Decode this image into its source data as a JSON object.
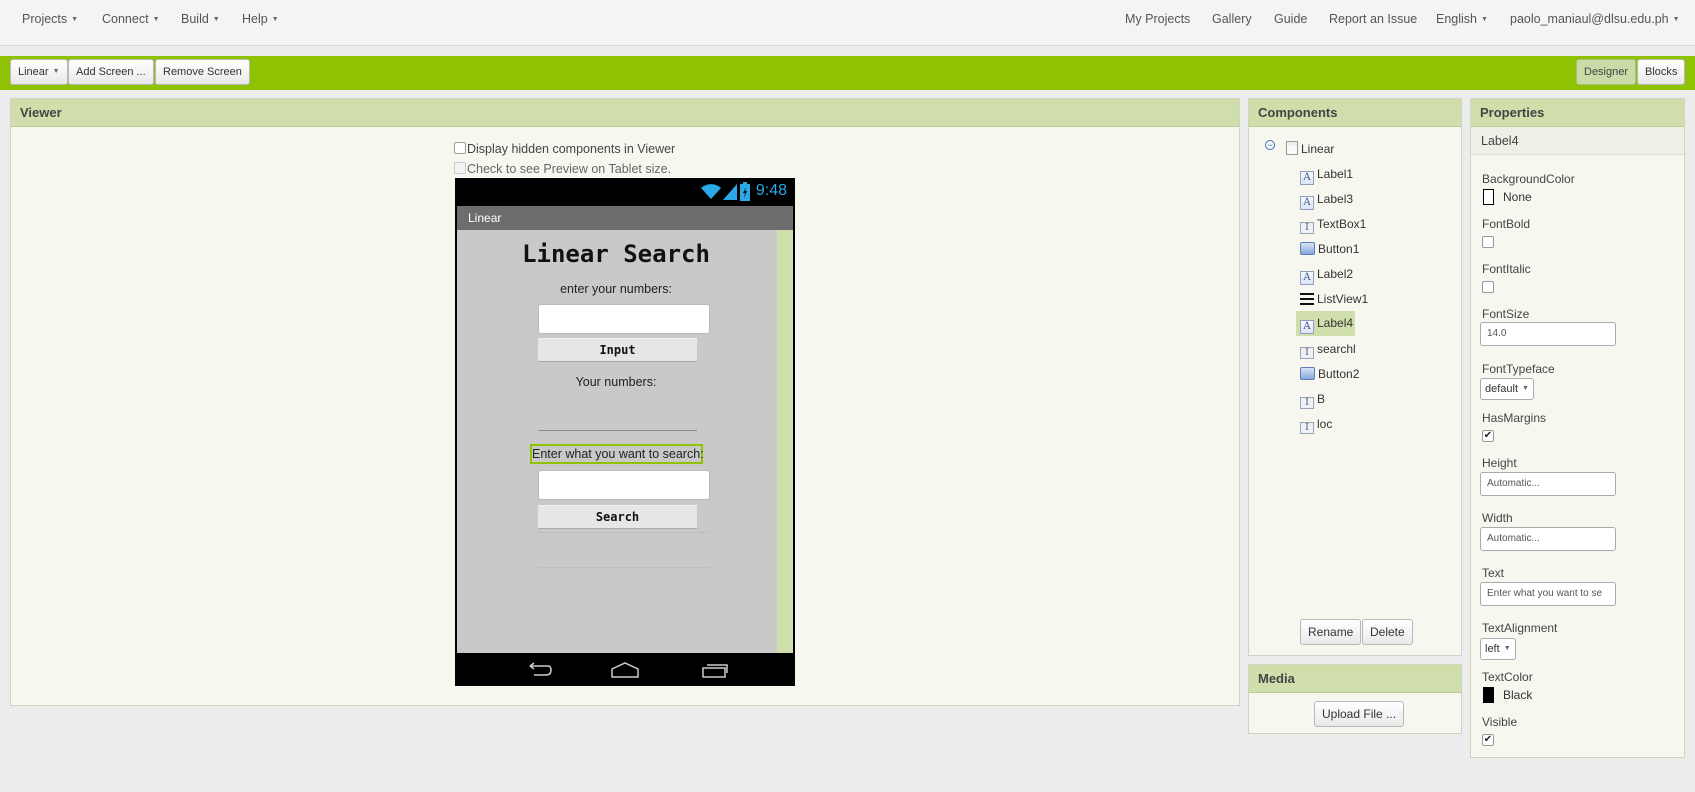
{
  "topnav": {
    "left": [
      "Projects",
      "Connect",
      "Build",
      "Help"
    ],
    "right": {
      "my_projects": "My Projects",
      "gallery": "Gallery",
      "guide": "Guide",
      "report": "Report an Issue",
      "language": "English",
      "account": "paolo_maniaul@dlsu.edu.ph"
    }
  },
  "toolbar": {
    "screen_select": "Linear",
    "add_screen": "Add Screen ...",
    "remove_screen": "Remove Screen",
    "designer": "Designer",
    "blocks": "Blocks"
  },
  "viewer": {
    "title": "Viewer",
    "display_hidden": "Display hidden components in Viewer",
    "tablet_preview": "Check to see Preview on Tablet size.",
    "phone": {
      "time": "9:48",
      "screen_title": "Linear",
      "app_title": "Linear Search",
      "label_enter_numbers": "enter your numbers:",
      "button_input": "Input",
      "label_your_numbers": "Your numbers:",
      "label_enter_search": "Enter what you want to search:",
      "button_search": "Search"
    }
  },
  "components": {
    "title": "Components",
    "root": "Linear",
    "items": [
      {
        "name": "Label1",
        "icon": "label-icon"
      },
      {
        "name": "Label3",
        "icon": "label-icon"
      },
      {
        "name": "TextBox1",
        "icon": "textbox-icon"
      },
      {
        "name": "Button1",
        "icon": "button-icon"
      },
      {
        "name": "Label2",
        "icon": "label-icon"
      },
      {
        "name": "ListView1",
        "icon": "listview-icon"
      },
      {
        "name": "Label4",
        "icon": "label-icon",
        "selected": true
      },
      {
        "name": "searchl",
        "icon": "textbox-icon"
      },
      {
        "name": "Button2",
        "icon": "button-icon"
      },
      {
        "name": "B",
        "icon": "textbox-icon"
      },
      {
        "name": "loc",
        "icon": "textbox-icon"
      }
    ],
    "rename": "Rename",
    "delete": "Delete"
  },
  "media": {
    "title": "Media",
    "upload": "Upload File ..."
  },
  "properties": {
    "title": "Properties",
    "selected": "Label4",
    "background_color": {
      "label": "BackgroundColor",
      "value": "None",
      "swatch": "#ffffff"
    },
    "font_bold": {
      "label": "FontBold",
      "checked": false
    },
    "font_italic": {
      "label": "FontItalic",
      "checked": false
    },
    "font_size": {
      "label": "FontSize",
      "value": "14.0"
    },
    "font_typeface": {
      "label": "FontTypeface",
      "value": "default"
    },
    "has_margins": {
      "label": "HasMargins",
      "checked": true
    },
    "height": {
      "label": "Height",
      "value": "Automatic..."
    },
    "width": {
      "label": "Width",
      "value": "Automatic..."
    },
    "text": {
      "label": "Text",
      "value": "Enter what you want to se"
    },
    "text_alignment": {
      "label": "TextAlignment",
      "value": "left"
    },
    "text_color": {
      "label": "TextColor",
      "value": "Black",
      "swatch": "#000000"
    },
    "visible": {
      "label": "Visible",
      "checked": true
    }
  },
  "colors": {
    "toolbar_green": "#8fc202",
    "panel_header": "#cfdeab",
    "status_time": "#2aa8e8"
  }
}
